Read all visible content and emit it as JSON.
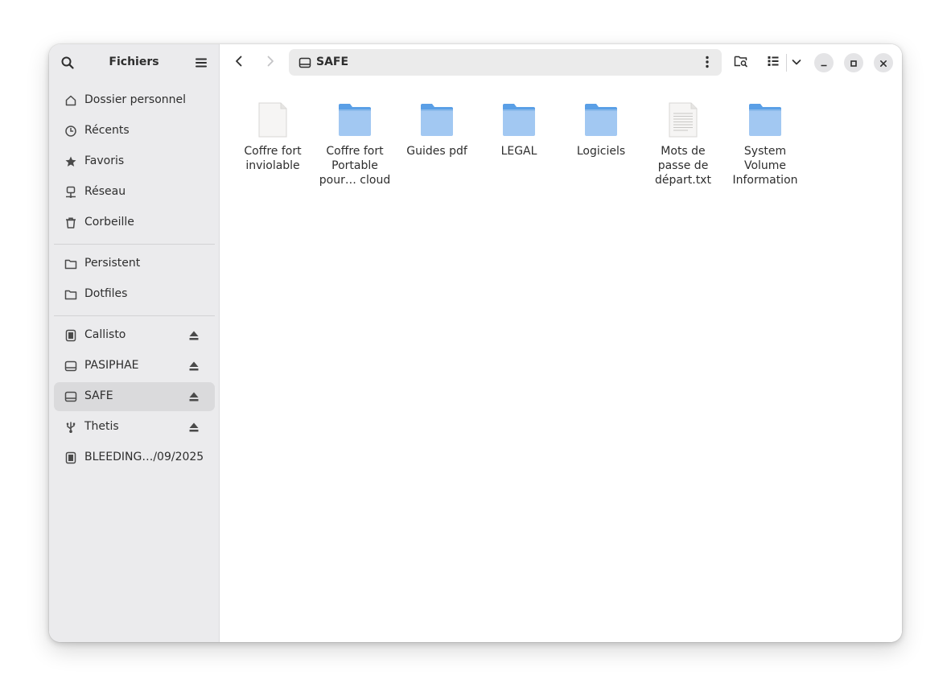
{
  "sidebar": {
    "title": "Fichiers",
    "search_icon": "search-icon",
    "menu_icon": "hamburger-menu-icon",
    "places": [
      {
        "label": "Dossier personnel",
        "icon": "home-icon"
      },
      {
        "label": "Récents",
        "icon": "clock-icon"
      },
      {
        "label": "Favoris",
        "icon": "star-icon"
      },
      {
        "label": "Réseau",
        "icon": "network-icon"
      },
      {
        "label": "Corbeille",
        "icon": "trash-icon"
      }
    ],
    "bookmarks": [
      {
        "label": "Persistent",
        "icon": "folder-icon"
      },
      {
        "label": "Dotfiles",
        "icon": "folder-icon"
      }
    ],
    "devices": [
      {
        "label": "Callisto",
        "icon": "drive-icon",
        "eject": true
      },
      {
        "label": "PASIPHAE",
        "icon": "disk-icon",
        "eject": true
      },
      {
        "label": "SAFE",
        "icon": "disk-icon",
        "eject": true,
        "selected": true
      },
      {
        "label": "Thetis",
        "icon": "usb-icon",
        "eject": true
      },
      {
        "label": "BLEEDING…/09/2025",
        "icon": "drive-icon",
        "eject": false
      }
    ]
  },
  "header": {
    "path_label": "SAFE",
    "path_icon": "disk-icon",
    "back_icon": "chevron-left-icon",
    "forward_icon": "chevron-right-icon",
    "more_icon": "vertical-dots-icon",
    "search_folder_icon": "folder-search-icon",
    "view_icon": "list-view-icon",
    "view_options_icon": "chevron-down-icon",
    "minimize_icon": "minimize-icon",
    "maximize_icon": "maximize-icon",
    "close_icon": "close-icon"
  },
  "files": [
    {
      "name": "Coffre fort\ninviolable",
      "type": "file-blank"
    },
    {
      "name": "Coffre fort\nPortable\npour… cloud",
      "type": "folder"
    },
    {
      "name": "Guides pdf",
      "type": "folder"
    },
    {
      "name": "LEGAL",
      "type": "folder"
    },
    {
      "name": "Logiciels",
      "type": "folder"
    },
    {
      "name": "Mots de\npasse de\ndépart.txt",
      "type": "file-text"
    },
    {
      "name": "System\nVolume\nInformation",
      "type": "folder"
    }
  ],
  "colors": {
    "folder": "#5a9fe6",
    "folder_light": "#a2c8f2",
    "sidebar_bg": "#ebebed",
    "selected_bg": "#dadadc"
  }
}
